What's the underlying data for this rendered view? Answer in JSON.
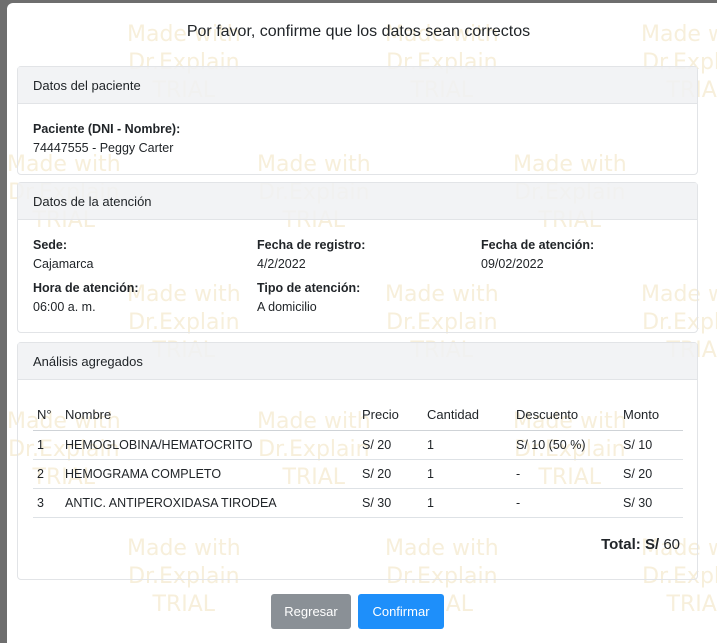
{
  "modal": {
    "title": "Por favor, confirme que los datos sean correctos"
  },
  "watermark": {
    "text": "Made with\nDr.Explain\nTRIAL"
  },
  "patient": {
    "header": "Datos del paciente",
    "label": "Paciente (DNI - Nombre):",
    "value": "74447555 - Peggy Carter"
  },
  "attention": {
    "header": "Datos de la atención",
    "sede_label": "Sede:",
    "sede_value": "Cajamarca",
    "registro_label": "Fecha de registro:",
    "registro_value": "4/2/2022",
    "atencion_label": "Fecha de atención:",
    "atencion_value": "09/02/2022",
    "hora_label": "Hora de atención:",
    "hora_value": "06:00 a. m.",
    "tipo_label": "Tipo de atención:",
    "tipo_value": "A domicilio"
  },
  "analysis": {
    "header": "Análisis agregados",
    "columns": [
      "N°",
      "Nombre",
      "Precio",
      "Cantidad",
      "Descuento",
      "Monto"
    ],
    "rows": [
      [
        "1",
        "HEMOGLOBINA/HEMATOCRITO",
        "S/ 20",
        "1",
        "S/ 10 (50 %)",
        "S/ 10"
      ],
      [
        "2",
        "HEMOGRAMA COMPLETO",
        "S/ 20",
        "1",
        "-",
        "S/ 20"
      ],
      [
        "3",
        "ANTIC. ANTIPEROXIDASA TIRODEA",
        "S/ 30",
        "1",
        "-",
        "S/ 30"
      ]
    ],
    "total_label": "Total: S/",
    "total_value": "60"
  },
  "buttons": {
    "back": "Regresar",
    "confirm": "Confirmar"
  },
  "colors": {
    "overlay": "#6e6e6e",
    "primary": "#1e8ffa",
    "secondary": "#8a9096"
  }
}
